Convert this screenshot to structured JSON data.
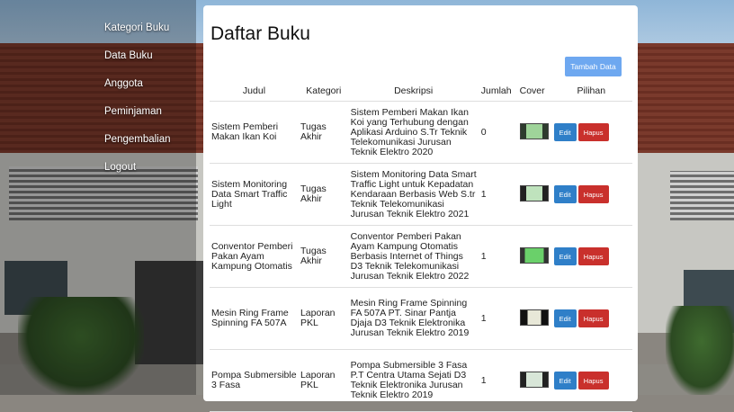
{
  "sidebar": {
    "items": [
      {
        "label": "Kategori Buku"
      },
      {
        "label": "Data Buku"
      },
      {
        "label": "Anggota"
      },
      {
        "label": "Peminjaman"
      },
      {
        "label": "Pengembalian"
      },
      {
        "label": "Logout"
      }
    ]
  },
  "main": {
    "title": "Daftar Buku",
    "add_button": "Tambah Data",
    "columns": [
      "Judul",
      "Kategori",
      "Deskripsi",
      "Jumlah",
      "Cover",
      "Pilihan"
    ],
    "rows": [
      {
        "judul": "Sistem Pemberi Makan Ikan Koi",
        "kategori": "Tugas Akhir",
        "deskripsi": "Sistem Pemberi Makan Ikan Koi yang Terhubung dengan Aplikasi Arduino S.Tr Teknik Telekomunikasi Jurusan Teknik Elektro 2020",
        "jumlah": "0",
        "edit": "Edit",
        "hapus": "Hapus"
      },
      {
        "judul": "Sistem Monitoring Data Smart Traffic Light",
        "kategori": "Tugas Akhir",
        "deskripsi": "Sistem Monitoring Data Smart Traffic Light untuk Kepadatan Kendaraan Berbasis Web S.tr Teknik Telekomunikasi Jurusan Teknik Elektro 2021",
        "jumlah": "1",
        "edit": "Edit",
        "hapus": "Hapus"
      },
      {
        "judul": "Conventor Pemberi Pakan Ayam Kampung Otomatis",
        "kategori": "Tugas Akhir",
        "deskripsi": "Conventor Pemberi Pakan Ayam Kampung Otomatis Berbasis Internet of Things D3 Teknik Telekomunikasi Jurusan Teknik Elektro 2022",
        "jumlah": "1",
        "edit": "Edit",
        "hapus": "Hapus"
      },
      {
        "judul": "Mesin Ring Frame Spinning FA 507A",
        "kategori": "Laporan PKL",
        "deskripsi": "Mesin Ring Frame Spinning FA 507A PT. Sinar Pantja Djaja D3 Teknik Elektronika Jurusan Teknik Elektro 2019",
        "jumlah": "1",
        "edit": "Edit",
        "hapus": "Hapus"
      },
      {
        "judul": "Pompa Submersible 3 Fasa",
        "kategori": "Laporan PKL",
        "deskripsi": "Pompa Submersible 3 Fasa P.T Centra Utama Sejati D3 Teknik Elektronika Jurusan Teknik Elektro 2019",
        "jumlah": "1",
        "edit": "Edit",
        "hapus": "Hapus"
      }
    ]
  },
  "colors": {
    "add_button": "#6ea8f0",
    "edit_button": "#2f7fc8",
    "delete_button": "#c9302c"
  }
}
